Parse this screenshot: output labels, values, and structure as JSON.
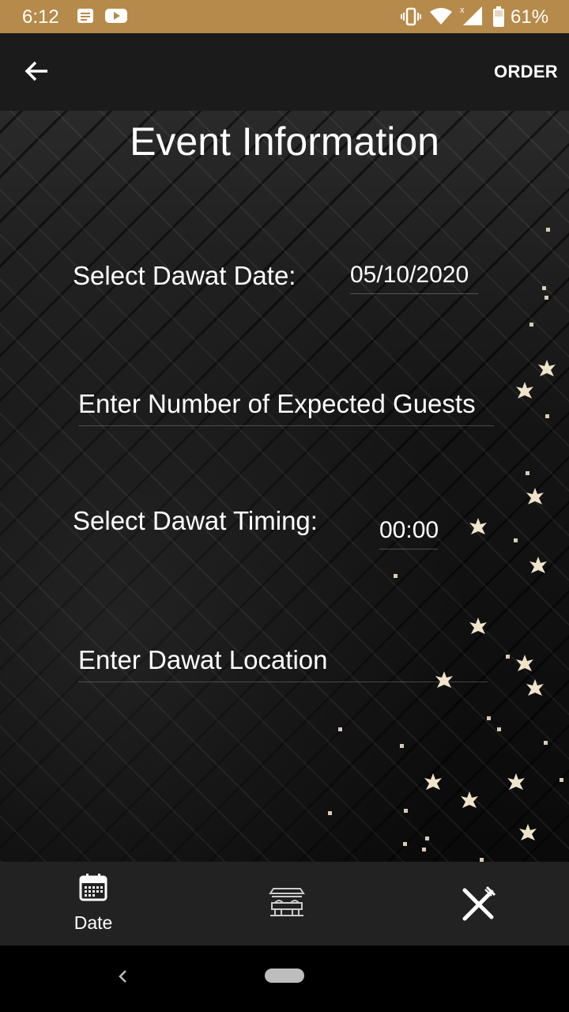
{
  "status_bar": {
    "time": "6:12",
    "battery_percent": "61%",
    "background_color": "#b68a4a",
    "icons": [
      "notification-icon",
      "youtube-icon",
      "vibrate-icon",
      "wifi-icon",
      "signal-icon",
      "battery-icon"
    ]
  },
  "app_bar": {
    "back_icon": "back-arrow-icon",
    "action_label": "ORDER"
  },
  "form": {
    "title": "Event Information",
    "date_label": "Select Dawat Date:",
    "date_value": "05/10/2020",
    "guests_placeholder": "Enter Number of Expected Guests",
    "timing_label": "Select Dawat Timing:",
    "timing_value": "00:00",
    "location_placeholder": "Enter Dawat Location"
  },
  "bottom_nav": {
    "items": [
      {
        "icon": "calendar-icon",
        "label": "Date"
      },
      {
        "icon": "venue-icon",
        "label": ""
      },
      {
        "icon": "cutlery-icon",
        "label": ""
      }
    ]
  },
  "system_nav": {
    "icons": [
      "system-back-icon",
      "home-pill-icon"
    ]
  }
}
